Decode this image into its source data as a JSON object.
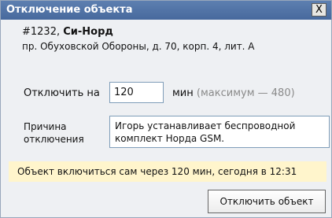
{
  "window": {
    "title": "Отключение объекта",
    "close_label": "X"
  },
  "object": {
    "number": "#1232,",
    "name": "Си-Норд",
    "address": "пр. Обуховской Обороны, д. 70, корп. 4, лит. А"
  },
  "form": {
    "disable_label": "Отключить на",
    "minutes_value": "120",
    "unit_label": "мин",
    "max_hint": "(максимум — 480)",
    "reason_label": "Причина отключения",
    "reason_text": "Игорь устанавливает беспроводной комплект Норда GSM."
  },
  "notice": {
    "text": "Объект включиться сам через 120 мин, сегодня в 12:31"
  },
  "actions": {
    "submit_label": "Отключить объект"
  },
  "colors": {
    "titlebar": "#4f72a7",
    "notice_bg": "#fff5cc",
    "hint": "#8a8a8a"
  }
}
